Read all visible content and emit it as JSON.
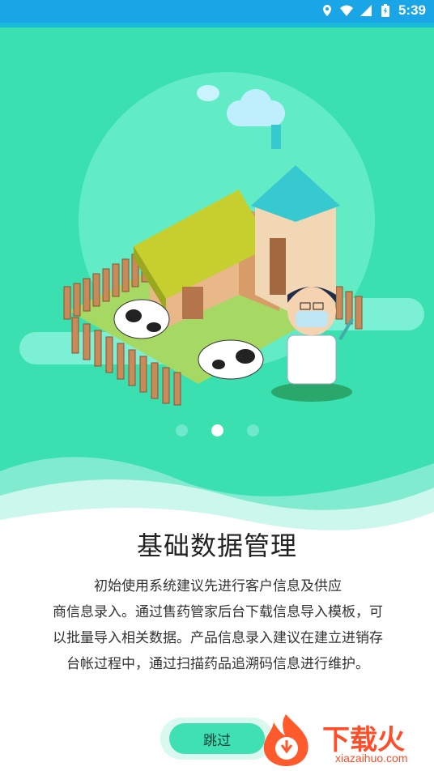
{
  "status": {
    "time": "5:39"
  },
  "onboarding": {
    "title": "基础数据管理",
    "desc_lines": [
      "初始使用系统建议先进行客户信息及供应",
      "商信息录入。通过售药管家后台下载信息导入模板，可",
      "以批量导入相关数据。产品信息录入建议在建立进销存",
      "台帐过程中，通过扫描药品追溯码信息进行维护。"
    ],
    "skip_label": "跳过",
    "page_total": 3,
    "page_current": 2
  },
  "watermark": {
    "text": "下载火",
    "sub": "xiazaihuo.com"
  },
  "colors": {
    "status_bar": "#1aa5e6",
    "hero": "#3ae0b0",
    "button": "#3fe0b3"
  }
}
